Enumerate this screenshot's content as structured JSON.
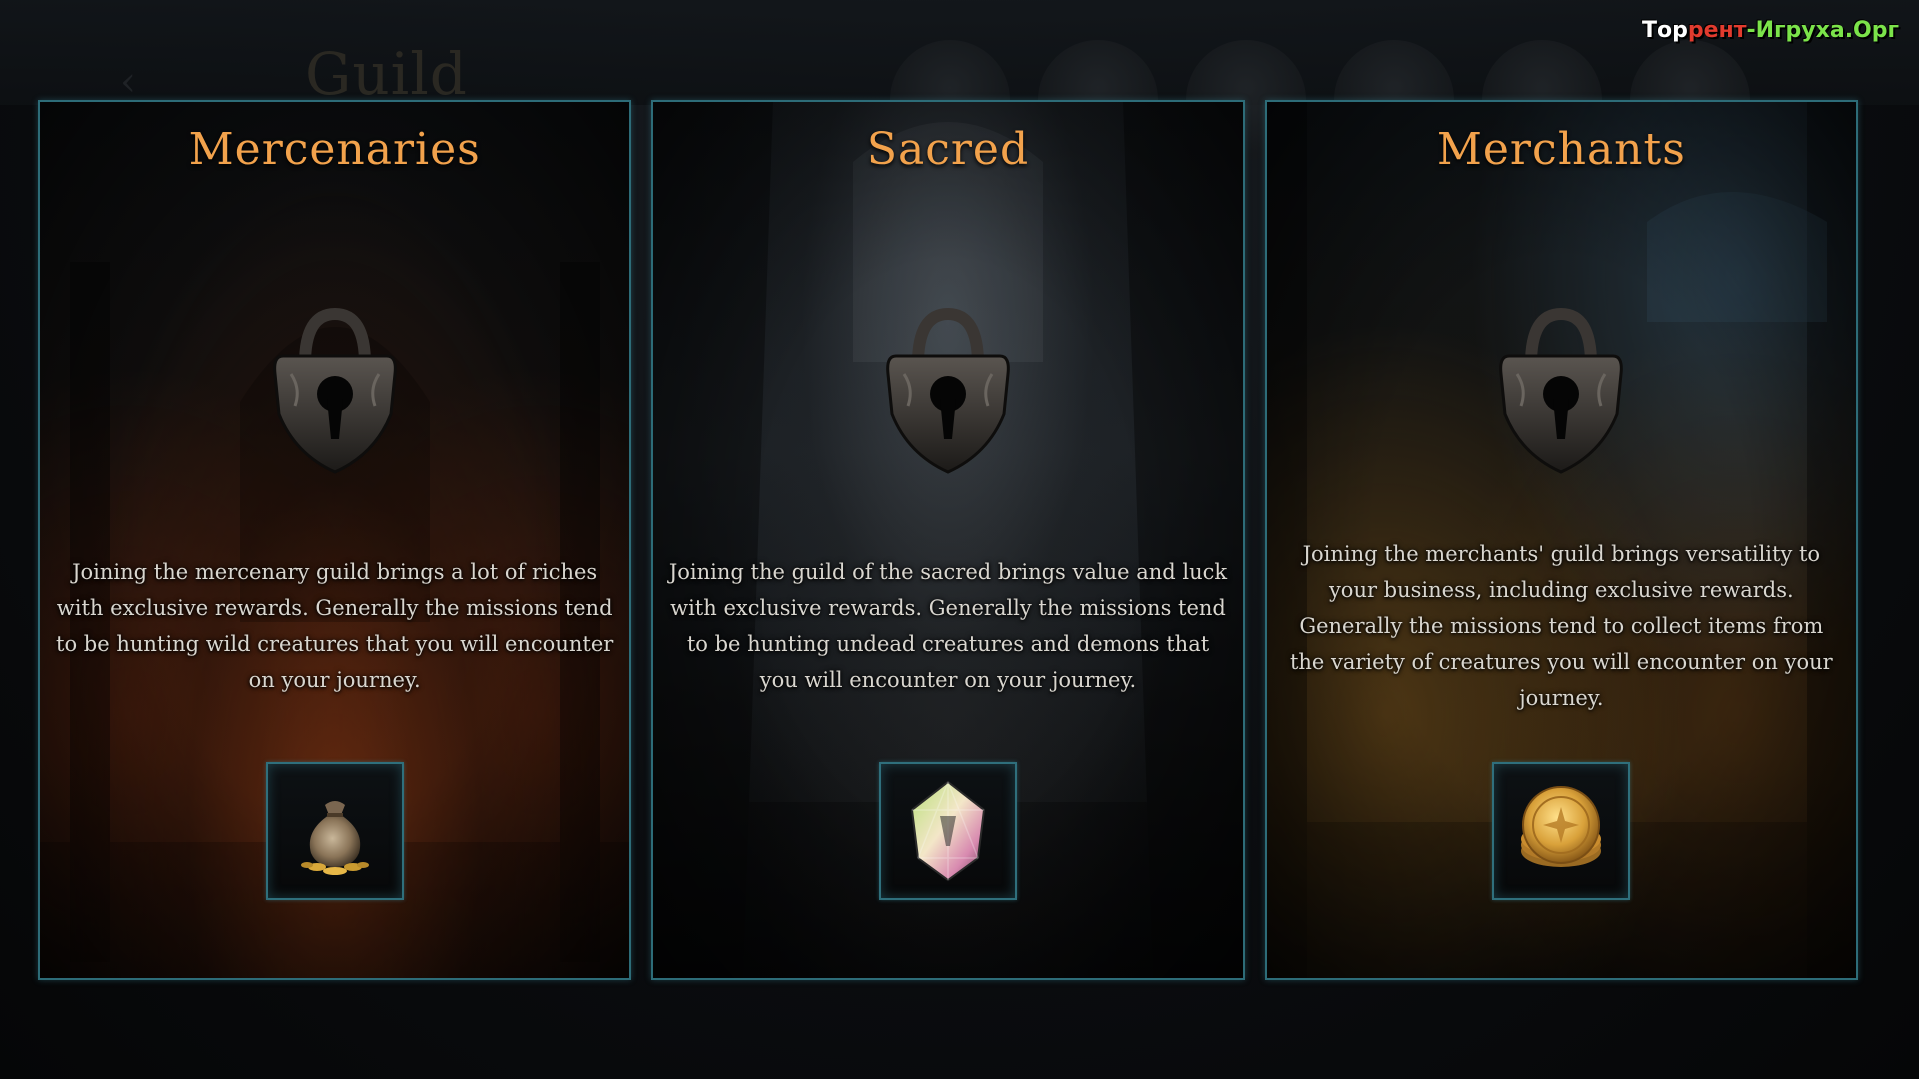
{
  "background": {
    "title": "Guild"
  },
  "watermark": {
    "part1": "Тор",
    "part2": "рент",
    "part3": "-Игруха",
    "part4": ".Орг"
  },
  "guilds": [
    {
      "id": "mercenaries",
      "title": "Mercenaries",
      "description": "Joining the mercenary guild brings a lot of riches with exclusive rewards. Generally the missions tend to be hunting wild creatures that you will encounter on your journey.",
      "locked": true,
      "reward_icon": "gold-bag-icon"
    },
    {
      "id": "sacred",
      "title": "Sacred",
      "description": "Joining the guild of the sacred brings value and luck with exclusive rewards. Generally the missions tend to be hunting undead creatures and demons that you will encounter on your journey.",
      "locked": true,
      "reward_icon": "crystal-gem-icon"
    },
    {
      "id": "merchants",
      "title": "Merchants",
      "description": "Joining the merchants' guild brings versatility to your business, including exclusive rewards. Generally the missions tend to collect items from the variety of creatures you will encounter on your journey.",
      "locked": true,
      "reward_icon": "gold-coin-stack-icon"
    }
  ],
  "colors": {
    "title": "#f2a24c",
    "border": "#2d6c78",
    "text": "#d9d6cf"
  }
}
